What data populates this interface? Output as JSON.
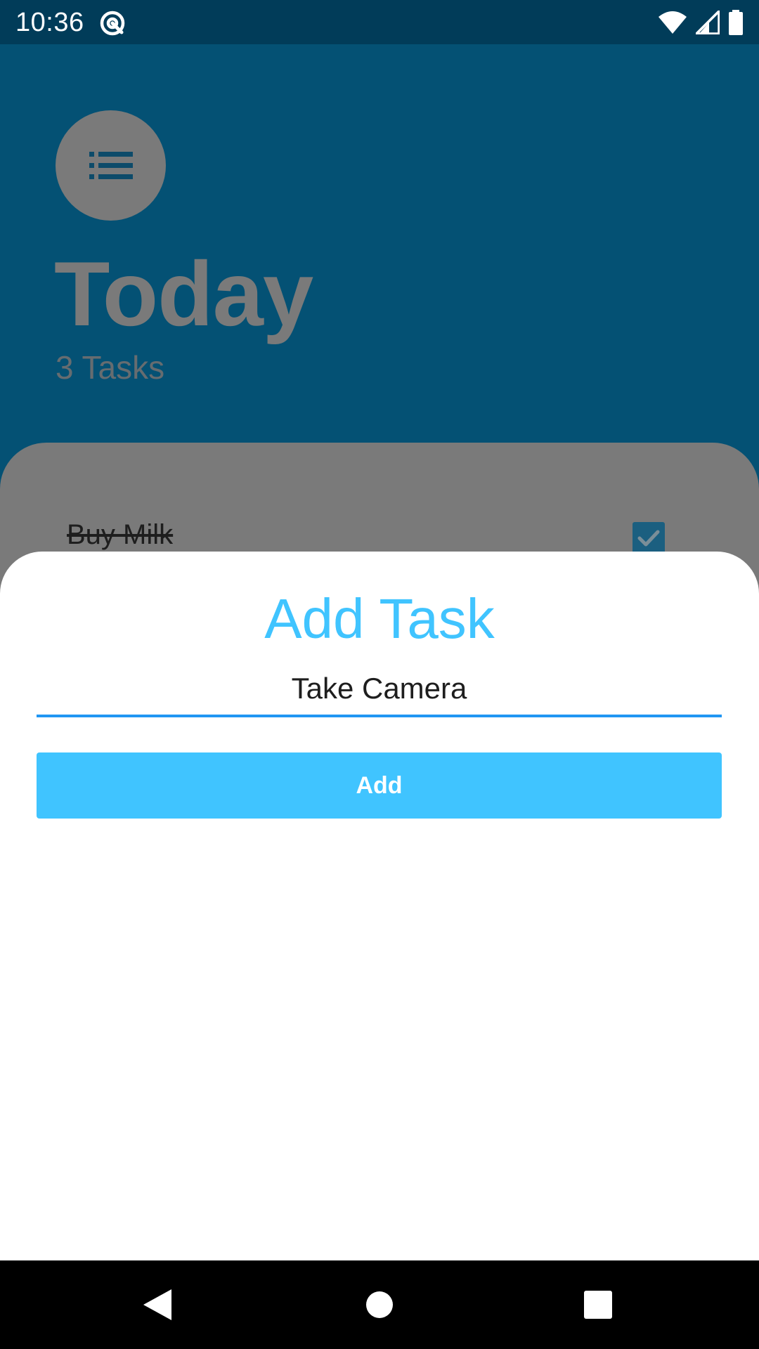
{
  "status_bar": {
    "time": "10:36",
    "icons": [
      "at-sign-icon",
      "wifi-icon",
      "signal-icon",
      "battery-icon"
    ]
  },
  "background_app": {
    "list_icon": "list-icon",
    "title": "Today",
    "task_count": "3 Tasks",
    "tasks": [
      {
        "label": "Buy Milk",
        "done": true
      }
    ]
  },
  "add_task_sheet": {
    "title": "Add Task",
    "input_value": "Take Camera",
    "add_button_label": "Add"
  },
  "nav_bar": {
    "buttons": [
      "back-icon",
      "home-icon",
      "recents-icon"
    ]
  },
  "colors": {
    "accent": "#40c4ff",
    "underline": "#2196f3",
    "app_background": "#045174",
    "status_bar": "#013c59",
    "scrim_gray": "#7a7a7a"
  }
}
